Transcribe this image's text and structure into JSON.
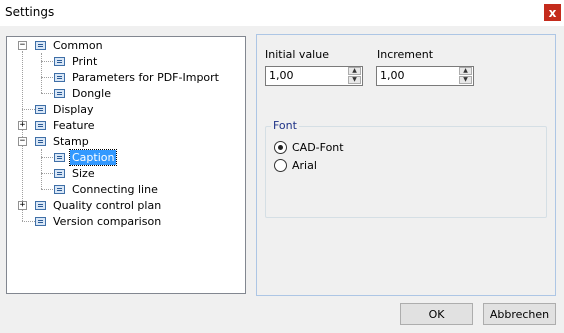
{
  "window": {
    "title": "Settings",
    "close_glyph": "x"
  },
  "tree": {
    "items": [
      {
        "label": "Common",
        "expander": "−"
      },
      {
        "label": "Print"
      },
      {
        "label": "Parameters for PDF-Import"
      },
      {
        "label": "Dongle"
      },
      {
        "label": "Display"
      },
      {
        "label": "Feature",
        "expander": "+"
      },
      {
        "label": "Stamp",
        "expander": "−"
      },
      {
        "label": "Caption",
        "selected": true
      },
      {
        "label": "Size"
      },
      {
        "label": "Connecting line"
      },
      {
        "label": "Quality control plan",
        "expander": "+"
      },
      {
        "label": "Version comparison"
      }
    ]
  },
  "fields": {
    "initial_value": {
      "label": "Initial value",
      "value": "1,00"
    },
    "increment": {
      "label": "Increment",
      "value": "1,00"
    }
  },
  "spin_glyphs": {
    "up": "▲",
    "down": "▼"
  },
  "font_group": {
    "title": "Font",
    "options": [
      {
        "label": "CAD-Font",
        "selected": true
      },
      {
        "label": "Arial",
        "selected": false
      }
    ]
  },
  "buttons": {
    "ok": "OK",
    "cancel": "Abbrechen"
  },
  "colors": {
    "close": "#c42b1c",
    "selection": "#3399ff",
    "group_title": "#1e3287"
  }
}
